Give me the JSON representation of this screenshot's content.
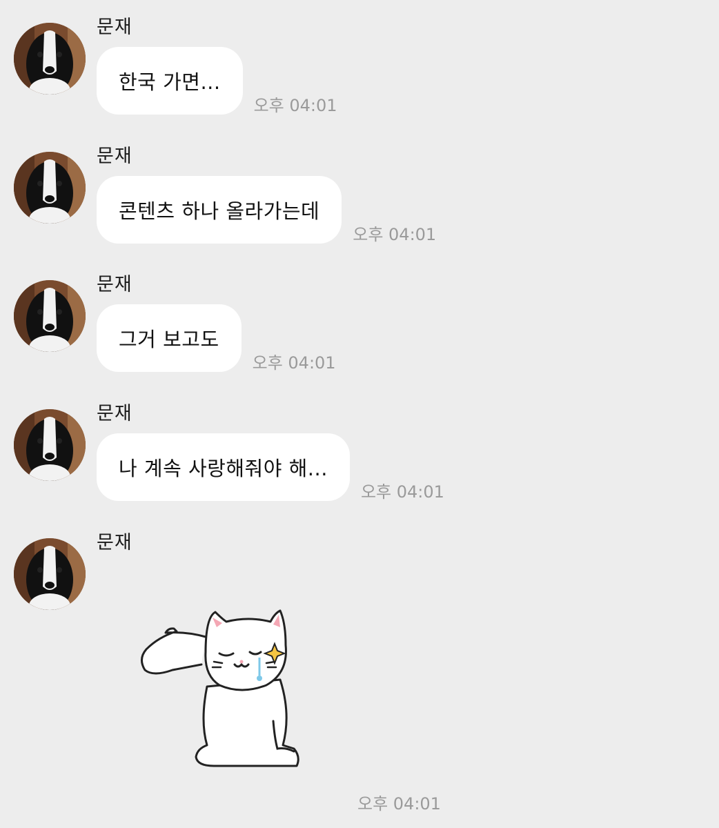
{
  "chat": {
    "sender_name": "문재",
    "messages": [
      {
        "sender": "문재",
        "text": "한국 가면...",
        "time": "오후 04:01"
      },
      {
        "sender": "문재",
        "text": "콘텐츠 하나 올라가는데",
        "time": "오후 04:01"
      },
      {
        "sender": "문재",
        "text": "그거 보고도",
        "time": "오후 04:01"
      },
      {
        "sender": "문재",
        "text": "나 계속 사랑해줘야 해...",
        "time": "오후 04:01"
      }
    ],
    "sticker_message": {
      "sender": "문재",
      "sticker": "white-cat-salute-crying-sticker",
      "time": "오후 04:01"
    }
  },
  "colors": {
    "background": "#ededed",
    "bubble": "#ffffff",
    "timestamp": "#9a9a9a"
  },
  "icons": {
    "avatar": "border-collie-dog-avatar",
    "sticker": "white-cat-sticker"
  }
}
